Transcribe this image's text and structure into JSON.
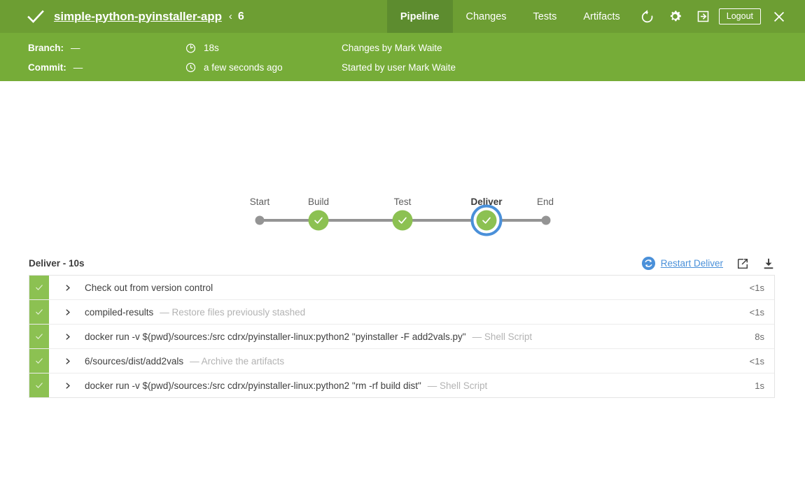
{
  "header": {
    "status_icon": "check-icon",
    "project_name": "simple-python-pyinstaller-app",
    "separator": "‹",
    "run_number": "6",
    "tabs": [
      {
        "label": "Pipeline",
        "active": true
      },
      {
        "label": "Changes",
        "active": false
      },
      {
        "label": "Tests",
        "active": false
      },
      {
        "label": "Artifacts",
        "active": false
      }
    ],
    "replay_icon": "replay-icon",
    "settings_icon": "gear-icon",
    "login_icon": "login-arrow-icon",
    "logout_label": "Logout",
    "close_icon": "close-icon"
  },
  "meta": {
    "branch_label": "Branch:",
    "branch_value": "—",
    "commit_label": "Commit:",
    "commit_value": "—",
    "duration_icon": "stopwatch-icon",
    "duration_value": "18s",
    "time_icon": "clock-icon",
    "time_value": "a few seconds ago",
    "changes_by": "Changes by Mark Waite",
    "started_by": "Started by user Mark Waite"
  },
  "graph": {
    "nodes": [
      {
        "label": "Start",
        "type": "dot",
        "selected": false
      },
      {
        "label": "Build",
        "type": "success",
        "selected": false
      },
      {
        "label": "Test",
        "type": "success",
        "selected": false
      },
      {
        "label": "Deliver",
        "type": "success",
        "selected": true
      },
      {
        "label": "End",
        "type": "dot",
        "selected": false
      }
    ]
  },
  "panel": {
    "title": "Deliver - 10s",
    "restart_icon": "restart-circle-icon",
    "restart_label": "Restart Deliver",
    "open_external_icon": "open-in-new-icon",
    "download_icon": "download-icon",
    "steps": [
      {
        "status": "success",
        "expander": "chevron-right-icon",
        "name": "Check out from version control",
        "description": "",
        "duration": "<1s"
      },
      {
        "status": "success",
        "expander": "chevron-right-icon",
        "name": "compiled-results",
        "description": "— Restore files previously stashed",
        "duration": "<1s"
      },
      {
        "status": "success",
        "expander": "chevron-right-icon",
        "name": "docker run -v $(pwd)/sources:/src cdrx/pyinstaller-linux:python2 \"pyinstaller -F add2vals.py\"",
        "description": "— Shell Script",
        "duration": "8s"
      },
      {
        "status": "success",
        "expander": "chevron-right-icon",
        "name": "6/sources/dist/add2vals",
        "description": "— Archive the artifacts",
        "duration": "<1s"
      },
      {
        "status": "success",
        "expander": "chevron-right-icon",
        "name": "docker run -v $(pwd)/sources:/src cdrx/pyinstaller-linux:python2 \"rm -rf build dist\"",
        "description": "— Shell Script",
        "duration": "1s"
      }
    ]
  },
  "colors": {
    "header_green": "#6d9e33",
    "subheader_green": "#76ac38",
    "active_tab_green": "#5d8c2f",
    "success_green": "#8cc152",
    "selection_blue": "#4a90d9",
    "idle_gray": "#949494"
  }
}
